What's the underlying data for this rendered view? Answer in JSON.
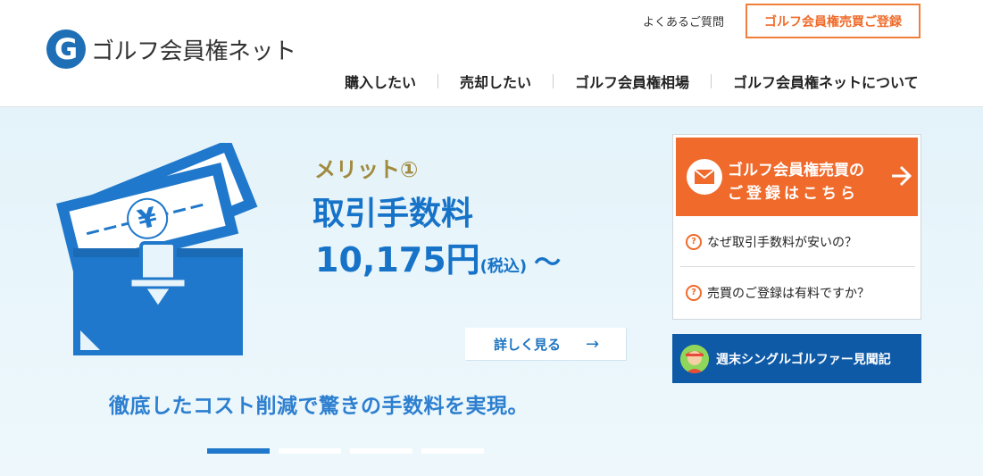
{
  "header": {
    "logo_mark": "G",
    "logo_text": "ゴルフ会員権ネット",
    "faq_link": "よくあるご質問",
    "register_button": "ゴルフ会員権売買ご登録",
    "nav": [
      "購入したい",
      "売却したい",
      "ゴルフ会員権相場",
      "ゴルフ会員権ネットについて"
    ]
  },
  "hero": {
    "merit_label": "メリット①",
    "fee_title": "取引手数料",
    "fee_amount": "10,175円",
    "fee_tax": "(税込)",
    "fee_tilde": "〜",
    "yen_symbol": "¥",
    "detail_button": "詳しく見る",
    "detail_arrow": "→",
    "tagline": "徹底したコスト削減で驚きの手数料を実現。",
    "slides_total": 4,
    "slide_active": 1
  },
  "side": {
    "cta_line1": "ゴルフ会員権売買の",
    "cta_line2": "ご登録はこちら",
    "faq": [
      {
        "q": "?",
        "text": "なぜ取引手数料が安いの？"
      },
      {
        "q": "?",
        "text": "売買のご登録は有料ですか？"
      }
    ],
    "golfer_link": "週末シングルゴルファー見聞記"
  },
  "colors": {
    "accent_orange": "#ef6a2b",
    "brand_blue": "#1673c8",
    "dark_blue": "#0e5aa7",
    "merit_gold": "#a08a3d"
  },
  "icons": [
    "logo-g-icon",
    "money-box-icon",
    "mail-icon",
    "arrow-right-icon",
    "question-icon",
    "golfer-avatar-icon"
  ]
}
